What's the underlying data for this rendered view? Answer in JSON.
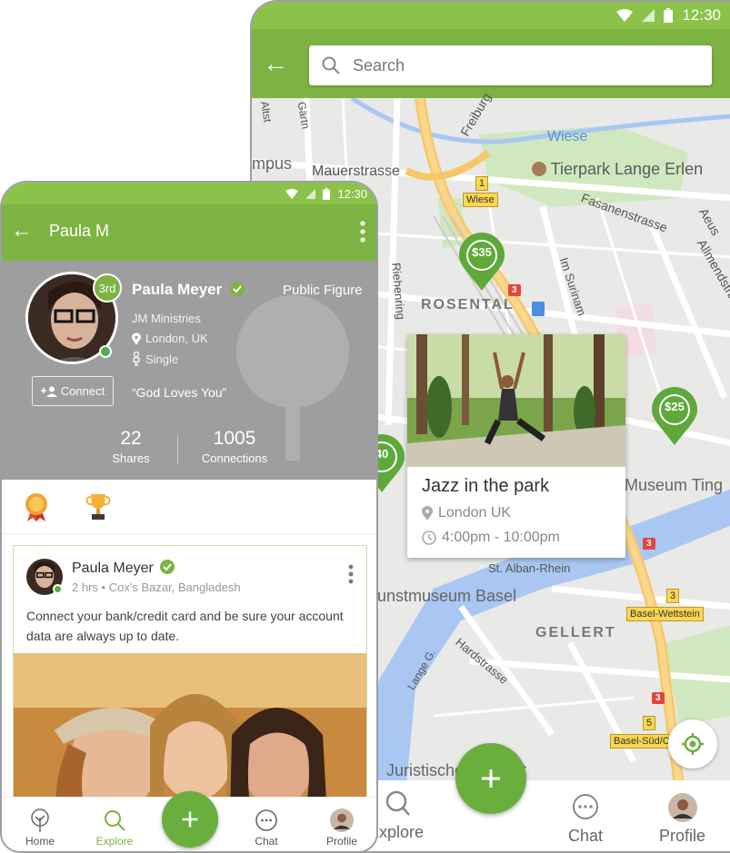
{
  "map_screen": {
    "status_bar": {
      "time": "12:30"
    },
    "search": {
      "placeholder": "Search"
    },
    "labels": {
      "mpus": "mpus",
      "mauerstrasse": "Mauerstrasse",
      "tierpark": "Tierpark Lange Erlen",
      "wiese_river": "Wiese",
      "fasanenstrasse": "Fasanenstrasse",
      "rosental": "ROSENTAL",
      "riehenring": "Riehenring",
      "im_surinam": "Im Surinam",
      "allmendstrasse": "Allmendstrasse",
      "freiburg": "Freiburg",
      "museum_tinguely": "Museum Ting",
      "st_alban": "St. Alban-Rhein",
      "kunstmuseum": "unstmuseum Basel",
      "gellert": "GELLERT",
      "hardstrasse": "Hardstrasse",
      "lange_g": "Lange G.",
      "juristische": "Juristische Fakultät",
      "aeus": "Aeus",
      "altst": "Altst",
      "gartn": "Gärtn"
    },
    "road_signs": {
      "wiese_sign": "Wiese",
      "route_1": "1",
      "route_3a": "3",
      "route_3b": "3",
      "route_3c": "3",
      "route_3d": "3",
      "route_5": "5",
      "basel_wettstein": "Basel-Wettstein",
      "basel_sud": "Basel-Süd/C"
    },
    "pins": {
      "p35": "$35",
      "p25": "$25",
      "p40": "40"
    },
    "event_card": {
      "title": "Jazz in the park",
      "location": "London UK",
      "time": "4:00pm - 10:00pm"
    },
    "bottom_nav": {
      "explore": "Explore",
      "chat": "Chat",
      "profile": "Profile"
    },
    "colors": {
      "primary": "#7cb342",
      "pin": "#5fa83a",
      "water": "#a9c7f2"
    }
  },
  "profile_screen": {
    "status_bar": {
      "time": "12:30"
    },
    "appbar_title": "Paula M",
    "header": {
      "rank": "3rd",
      "name": "Paula Meyer",
      "role": "Public Figure",
      "organization": "JM Ministries",
      "location": "London, UK",
      "relationship": "Single",
      "connect_label": "Connect",
      "quote": "“God Loves You”",
      "shares_count": "22",
      "shares_label": "Shares",
      "connections_count": "1005",
      "connections_label": "Connections"
    },
    "post": {
      "author": "Paula Meyer",
      "time": "2 hrs",
      "location": "Cox's Bazar, Bangladesh",
      "text": "Connect your bank/credit card and be sure your account data are always up to date."
    },
    "bottom_nav": {
      "home": "Home",
      "explore": "Explore",
      "chat": "Chat",
      "profile": "Profile"
    }
  }
}
